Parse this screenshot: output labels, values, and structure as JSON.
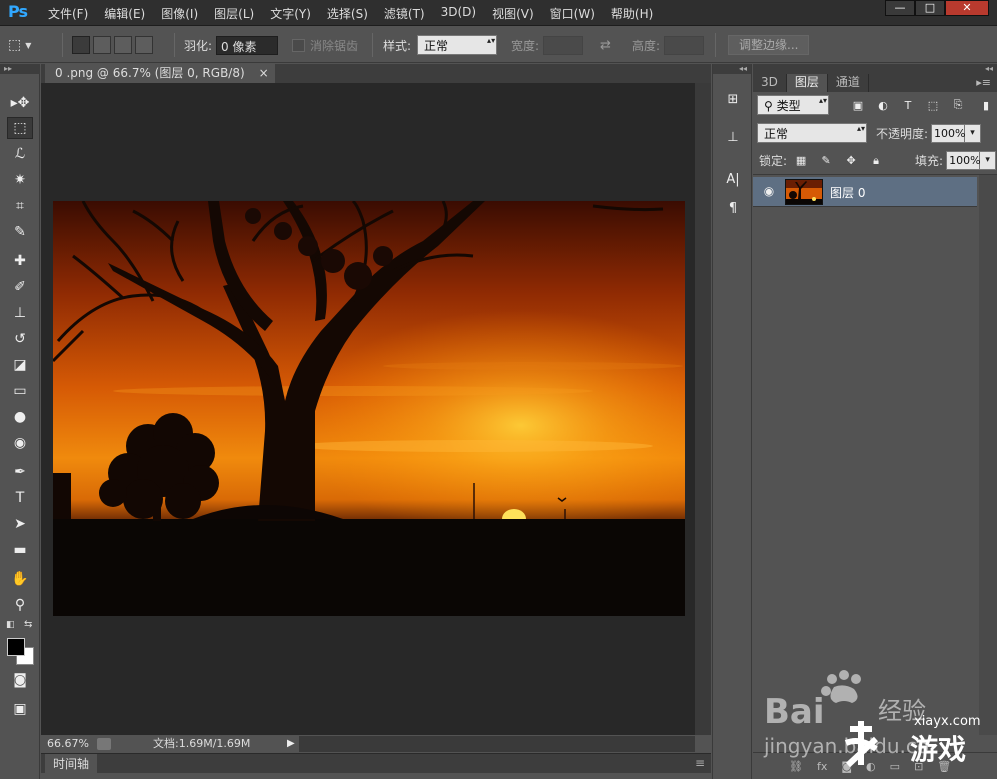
{
  "app": {
    "logo": "Ps"
  },
  "menu": [
    "文件(F)",
    "编辑(E)",
    "图像(I)",
    "图层(L)",
    "文字(Y)",
    "选择(S)",
    "滤镜(T)",
    "3D(D)",
    "视图(V)",
    "窗口(W)",
    "帮助(H)"
  ],
  "window_controls": {
    "minimize": "—",
    "maximize": "□",
    "close": "✕"
  },
  "options": {
    "feather_label": "羽化:",
    "feather_value": "0 像素",
    "antialias_label": "消除锯齿",
    "style_label": "样式:",
    "style_value": "正常",
    "width_label": "宽度:",
    "height_label": "高度:",
    "refine_button": "调整边缘..."
  },
  "tools": [
    {
      "name": "move-tool",
      "glyph": "▸✥"
    },
    {
      "name": "marquee-tool",
      "glyph": "⬚"
    },
    {
      "name": "lasso-tool",
      "glyph": "ℒ"
    },
    {
      "name": "magic-wand-tool",
      "glyph": "✷"
    },
    {
      "name": "crop-tool",
      "glyph": "⌗"
    },
    {
      "name": "eyedropper-tool",
      "glyph": "✎"
    },
    {
      "name": "healing-brush-tool",
      "glyph": "✚"
    },
    {
      "name": "brush-tool",
      "glyph": "✐"
    },
    {
      "name": "clone-stamp-tool",
      "glyph": "⊥"
    },
    {
      "name": "history-brush-tool",
      "glyph": "↺"
    },
    {
      "name": "eraser-tool",
      "glyph": "◪"
    },
    {
      "name": "gradient-tool",
      "glyph": "▭"
    },
    {
      "name": "blur-tool",
      "glyph": "●"
    },
    {
      "name": "dodge-tool",
      "glyph": "◉"
    },
    {
      "name": "pen-tool",
      "glyph": "✒"
    },
    {
      "name": "type-tool",
      "glyph": "T"
    },
    {
      "name": "path-selection-tool",
      "glyph": "➤"
    },
    {
      "name": "rectangle-tool",
      "glyph": "▬"
    },
    {
      "name": "hand-tool",
      "glyph": "✋"
    },
    {
      "name": "zoom-tool",
      "glyph": "⚲"
    }
  ],
  "document": {
    "tab_title": "0 .png @ 66.7% (图层 0, RGB/8)",
    "tab_close": "×",
    "zoom": "66.67%",
    "doc_info": "文档:1.69M/1.69M"
  },
  "timeline": {
    "label": "时间轴"
  },
  "layers_panel": {
    "tabs": [
      "3D",
      "图层",
      "通道"
    ],
    "active_tab": "图层",
    "filter_value": "类型",
    "blend_mode": "正常",
    "opacity_label": "不透明度:",
    "opacity_value": "100%",
    "lock_label": "锁定:",
    "fill_label": "填充:",
    "fill_value": "100%",
    "layers": [
      {
        "name": "图层 0",
        "visible": true
      }
    ]
  },
  "watermark": {
    "baidu_text": "Bai",
    "jingyan_text": "经验",
    "url_text": "jingyan.baidu.co",
    "site_text": "xiayx.com",
    "game_text": "游戏"
  },
  "colors": {
    "foreground": "#000000",
    "background": "#ffffff",
    "accent_logo": "#31a8ff",
    "selected_layer": "#5e6f83"
  }
}
